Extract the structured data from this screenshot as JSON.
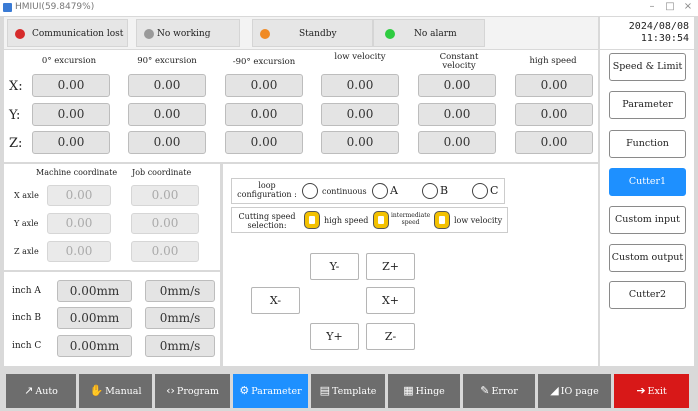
{
  "window": {
    "title": "HMIUI(59.8479%)"
  },
  "status": [
    {
      "label": "Communication lost",
      "color": "#d62b2b"
    },
    {
      "label": "No working surface",
      "color": "#9a9a9a"
    },
    {
      "label": "Standby",
      "color": "#f08a24"
    },
    {
      "label": "No alarm",
      "color": "#2ecc40"
    }
  ],
  "datetime": {
    "date": "2024/08/08",
    "time": "11:30:54"
  },
  "axes_table": {
    "headers": [
      "0° excursion",
      "90° excursion",
      "-90° excursion",
      "low velocity",
      "Constant velocity",
      "high speed"
    ],
    "rows": [
      {
        "axis": "X:",
        "values": [
          "0.00",
          "0.00",
          "0.00",
          "0.00",
          "0.00",
          "0.00"
        ]
      },
      {
        "axis": "Y:",
        "values": [
          "0.00",
          "0.00",
          "0.00",
          "0.00",
          "0.00",
          "0.00"
        ]
      },
      {
        "axis": "Z:",
        "values": [
          "0.00",
          "0.00",
          "0.00",
          "0.00",
          "0.00",
          "0.00"
        ]
      }
    ]
  },
  "coords": {
    "machine_header": "Machine coordinate",
    "job_header": "Job coordinate",
    "rows": [
      {
        "label": "X axle",
        "machine": "0.00",
        "job": "0.00"
      },
      {
        "label": "Y axle",
        "machine": "0.00",
        "job": "0.00"
      },
      {
        "label": "Z axle",
        "machine": "0.00",
        "job": "0.00"
      }
    ]
  },
  "inches": [
    {
      "label": "inch A",
      "value": "0.00mm",
      "speed": "0mm/s"
    },
    {
      "label": "inch B",
      "value": "0.00mm",
      "speed": "0mm/s"
    },
    {
      "label": "inch C",
      "value": "0.00mm",
      "speed": "0mm/s"
    }
  ],
  "loop": {
    "label_line1": "loop",
    "label_line2": "configuration :",
    "options": [
      "continuous",
      "A",
      "B",
      "C"
    ]
  },
  "cutting": {
    "label_line1": "Cutting speed",
    "label_line2": "selection:",
    "options": [
      {
        "l1": "high speed",
        "l2": ""
      },
      {
        "l1": "intermediate",
        "l2": "speed"
      },
      {
        "l1": "low velocity",
        "l2": ""
      }
    ]
  },
  "jog": {
    "y_minus": "Y-",
    "z_plus": "Z+",
    "x_minus": "X-",
    "x_plus": "X+",
    "y_plus": "Y+",
    "z_minus": "Z-"
  },
  "side_buttons": [
    "Speed & Limit",
    "Parameter",
    "Function",
    "Cutter1",
    "Custom input",
    "Custom output",
    "Cutter2"
  ],
  "side_active": 3,
  "nav": [
    {
      "label": "Auto",
      "icon": "↗"
    },
    {
      "label": "Manual",
      "icon": "✋"
    },
    {
      "label": "Program",
      "icon": "‹›"
    },
    {
      "label": "Parameter",
      "icon": "⚙"
    },
    {
      "label": "Template",
      "icon": "▤"
    },
    {
      "label": "Hinge",
      "icon": "▦"
    },
    {
      "label": "Error",
      "icon": "✎"
    },
    {
      "label": "IO page",
      "icon": "◢"
    },
    {
      "label": "Exit",
      "icon": "➔"
    }
  ],
  "nav_active": 3,
  "colors": {
    "accent": "#1e90ff",
    "exit": "#d81818"
  }
}
